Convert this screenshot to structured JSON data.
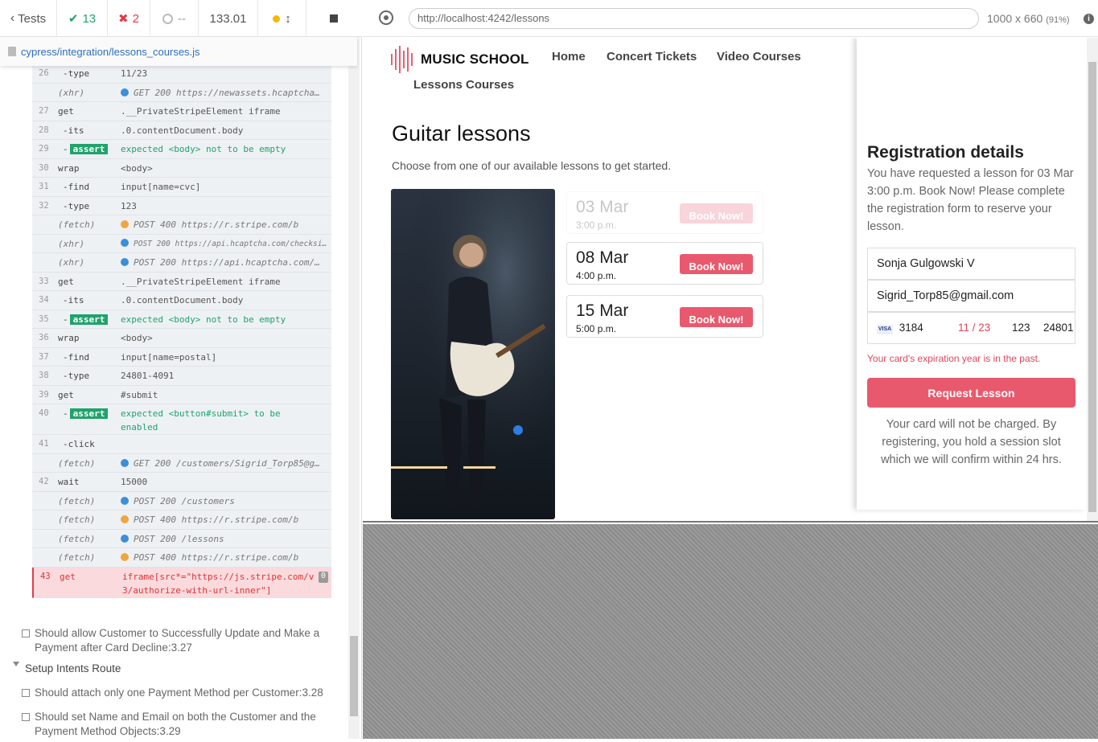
{
  "runner": {
    "back_label": "Tests",
    "passed": "13",
    "failed": "2",
    "pending": "--",
    "duration": "133.01",
    "spec_file": "cypress/integration/lessons_courses.js"
  },
  "commands": [
    {
      "num": "26",
      "name": "-type",
      "msg": "11/23",
      "kind": "child"
    },
    {
      "num": "",
      "name": "(xhr)",
      "msg": "GET 200 https://newassets.hcaptcha…",
      "kind": "event",
      "dot": "blue"
    },
    {
      "num": "27",
      "name": "get",
      "msg": ".__PrivateStripeElement iframe",
      "kind": "cmd"
    },
    {
      "num": "28",
      "name": "-its",
      "msg": ".0.contentDocument.body",
      "kind": "child"
    },
    {
      "num": "29",
      "name": "-",
      "badge": "assert",
      "msg": "expected <body> not to be empty",
      "kind": "assert"
    },
    {
      "num": "30",
      "name": "wrap",
      "msg": "<body>",
      "kind": "cmd"
    },
    {
      "num": "31",
      "name": "-find",
      "msg": "input[name=cvc]",
      "kind": "child"
    },
    {
      "num": "32",
      "name": "-type",
      "msg": "123",
      "kind": "child"
    },
    {
      "num": "",
      "name": "(fetch)",
      "msg": "POST 400 https://r.stripe.com/b",
      "kind": "event",
      "dot": "orange"
    },
    {
      "num": "",
      "name": "(xhr)",
      "msg": "POST 200 https://api.hcaptcha.com/checksi…",
      "kind": "event",
      "dot": "blue"
    },
    {
      "num": "",
      "name": "(xhr)",
      "msg": "POST 200 https://api.hcaptcha.com/…",
      "kind": "event",
      "dot": "blue"
    },
    {
      "num": "33",
      "name": "get",
      "msg": ".__PrivateStripeElement iframe",
      "kind": "cmd"
    },
    {
      "num": "34",
      "name": "-its",
      "msg": ".0.contentDocument.body",
      "kind": "child"
    },
    {
      "num": "35",
      "name": "-",
      "badge": "assert",
      "msg": "expected <body> not to be empty",
      "kind": "assert"
    },
    {
      "num": "36",
      "name": "wrap",
      "msg": "<body>",
      "kind": "cmd"
    },
    {
      "num": "37",
      "name": "-find",
      "msg": "input[name=postal]",
      "kind": "child"
    },
    {
      "num": "38",
      "name": "-type",
      "msg": "24801-4091",
      "kind": "child"
    },
    {
      "num": "39",
      "name": "get",
      "msg": "#submit",
      "kind": "cmd"
    },
    {
      "num": "40",
      "name": "-",
      "badge": "assert",
      "msg": "expected <button#submit> to be",
      "msg2": "enabled",
      "kind": "assert"
    },
    {
      "num": "41",
      "name": "-click",
      "msg": "",
      "kind": "child"
    },
    {
      "num": "",
      "name": "(fetch)",
      "msg": "GET 200 /customers/Sigrid_Torp85@g…",
      "kind": "event",
      "dot": "blue"
    },
    {
      "num": "42",
      "name": "wait",
      "msg": "15000",
      "kind": "cmd"
    },
    {
      "num": "",
      "name": "(fetch)",
      "msg": "POST 200 /customers",
      "kind": "event",
      "dot": "blue"
    },
    {
      "num": "",
      "name": "(fetch)",
      "msg": "POST 400 https://r.stripe.com/b",
      "kind": "event",
      "dot": "orange"
    },
    {
      "num": "",
      "name": "(fetch)",
      "msg": "POST 200 /lessons",
      "kind": "event",
      "dot": "blue"
    },
    {
      "num": "",
      "name": "(fetch)",
      "msg": "POST 400 https://r.stripe.com/b",
      "kind": "event",
      "dot": "orange"
    },
    {
      "num": "43",
      "name": "get",
      "msg": "iframe[src*=\"https://js.stripe.com/v",
      "msg2": "3/authorize-with-url-inner\"]",
      "kind": "failed",
      "count": "0"
    }
  ],
  "tests": {
    "t1": "Should allow Customer to Successfully Update and Make a Payment after Card Decline:3.27",
    "suite": "Setup Intents Route",
    "t2": "Should attach only one Payment Method per Customer:3.28",
    "t3": "Should set Name and Email on both the Customer and the Payment Method Objects:3.29"
  },
  "browser": {
    "url": "http://localhost:4242/lessons",
    "viewport": "1000 x 660",
    "scale": "(91%)"
  },
  "site": {
    "brand": "MUSIC SCHOOL",
    "nav": [
      "Home",
      "Concert Tickets",
      "Video Courses",
      "Lessons Courses"
    ],
    "heading": "Guitar lessons",
    "subheading": "Choose from one of our available lessons to get started.",
    "slots": [
      {
        "date": "03 Mar",
        "time": "3:00 p.m.",
        "button": "Book Now!"
      },
      {
        "date": "08 Mar",
        "time": "4:00 p.m.",
        "button": "Book Now!"
      },
      {
        "date": "15 Mar",
        "time": "5:00 p.m.",
        "button": "Book Now!"
      }
    ]
  },
  "registration": {
    "title": "Registration details",
    "intro": "You have requested a lesson for 03 Mar 3:00 p.m. Book Now! Please complete the registration form to reserve your lesson.",
    "name": "Sonja Gulgowski V",
    "email": "Sigrid_Torp85@gmail.com",
    "card_brand": "VISA",
    "card_last4": "3184",
    "card_exp": "11 / 23",
    "card_cvc": "123",
    "card_zip": "24801",
    "error": "Your card's expiration year is in the past.",
    "submit": "Request Lesson",
    "note": "Your card will not be charged. By registering, you hold a session slot which we will confirm within 24 hrs."
  },
  "colors": {
    "accent": "#e9596e",
    "pass": "#1fa36b",
    "fail": "#e03c4a",
    "link": "#2c6fbb"
  }
}
